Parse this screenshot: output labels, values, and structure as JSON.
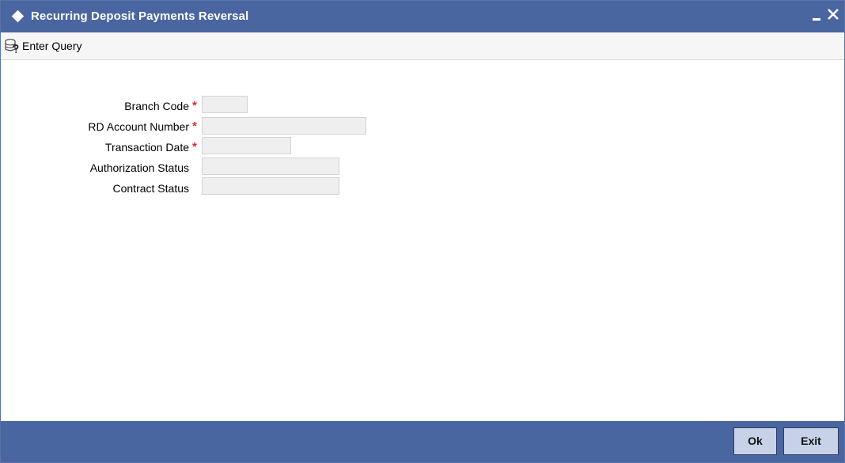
{
  "window": {
    "title": "Recurring Deposit Payments Reversal"
  },
  "toolbar": {
    "enter_query_label": "Enter Query"
  },
  "form": {
    "fields": [
      {
        "label": "Branch Code",
        "required_mark": "*",
        "value": ""
      },
      {
        "label": "RD Account Number",
        "required_mark": "*",
        "value": ""
      },
      {
        "label": "Transaction Date",
        "required_mark": "*",
        "value": ""
      },
      {
        "label": "Authorization Status",
        "value": ""
      },
      {
        "label": "Contract Status",
        "value": ""
      }
    ]
  },
  "footer": {
    "ok_label": "Ok",
    "exit_label": "Exit"
  },
  "colors": {
    "title_bar": "#4a66a0",
    "footer_bar": "#4a66a0",
    "required_mark": "#e4262d",
    "button_face": "#c7d2e8"
  }
}
